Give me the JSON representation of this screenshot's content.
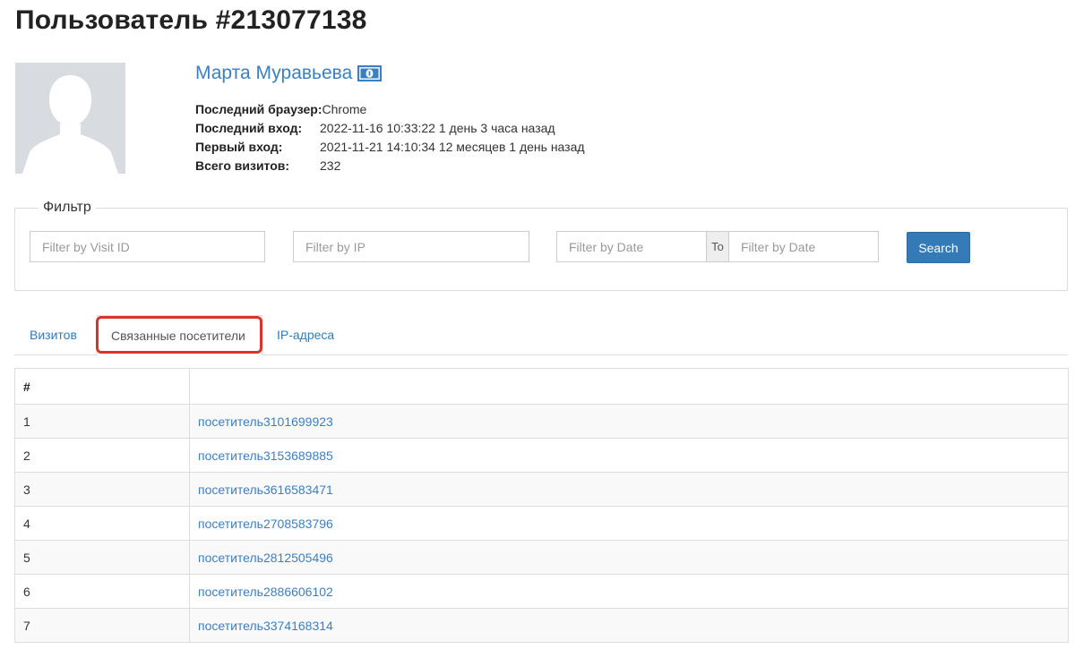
{
  "page": {
    "title": "Пользователь #213077138"
  },
  "profile": {
    "name": "Марта Муравьева",
    "badge_icon": "money-icon",
    "fields": [
      {
        "label": "Последний браузер:",
        "value": "Chrome"
      },
      {
        "label": "Последний вход:",
        "value": "2022-11-16 10:33:22 1 день 3 часа назад"
      },
      {
        "label": "Первый вход:",
        "value": "2021-11-21 14:10:34 12 месяцев 1 день назад"
      },
      {
        "label": "Всего визитов:",
        "value": "232"
      }
    ]
  },
  "filter": {
    "legend": "Фильтр",
    "visit_id_placeholder": "Filter by Visit ID",
    "ip_placeholder": "Filter by IP",
    "date_from_placeholder": "Filter by Date",
    "to_label": "To",
    "date_to_placeholder": "Filter by Date",
    "search_label": "Search"
  },
  "tabs": [
    {
      "label": "Визитов",
      "active": false
    },
    {
      "label": "Связанные посетители",
      "active": true
    },
    {
      "label": "IP-адреса",
      "active": false
    }
  ],
  "table": {
    "headers": [
      "#",
      ""
    ],
    "rows": [
      {
        "num": "1",
        "visitor": "посетитель3101699923"
      },
      {
        "num": "2",
        "visitor": "посетитель3153689885"
      },
      {
        "num": "3",
        "visitor": "посетитель3616583471"
      },
      {
        "num": "4",
        "visitor": "посетитель2708583796"
      },
      {
        "num": "5",
        "visitor": "посетитель2812505496"
      },
      {
        "num": "6",
        "visitor": "посетитель2886606102"
      },
      {
        "num": "7",
        "visitor": "посетитель3374168314"
      }
    ]
  },
  "colors": {
    "link": "#3c7fc1",
    "primary_button": "#337ab7",
    "highlight": "#d9342b"
  }
}
